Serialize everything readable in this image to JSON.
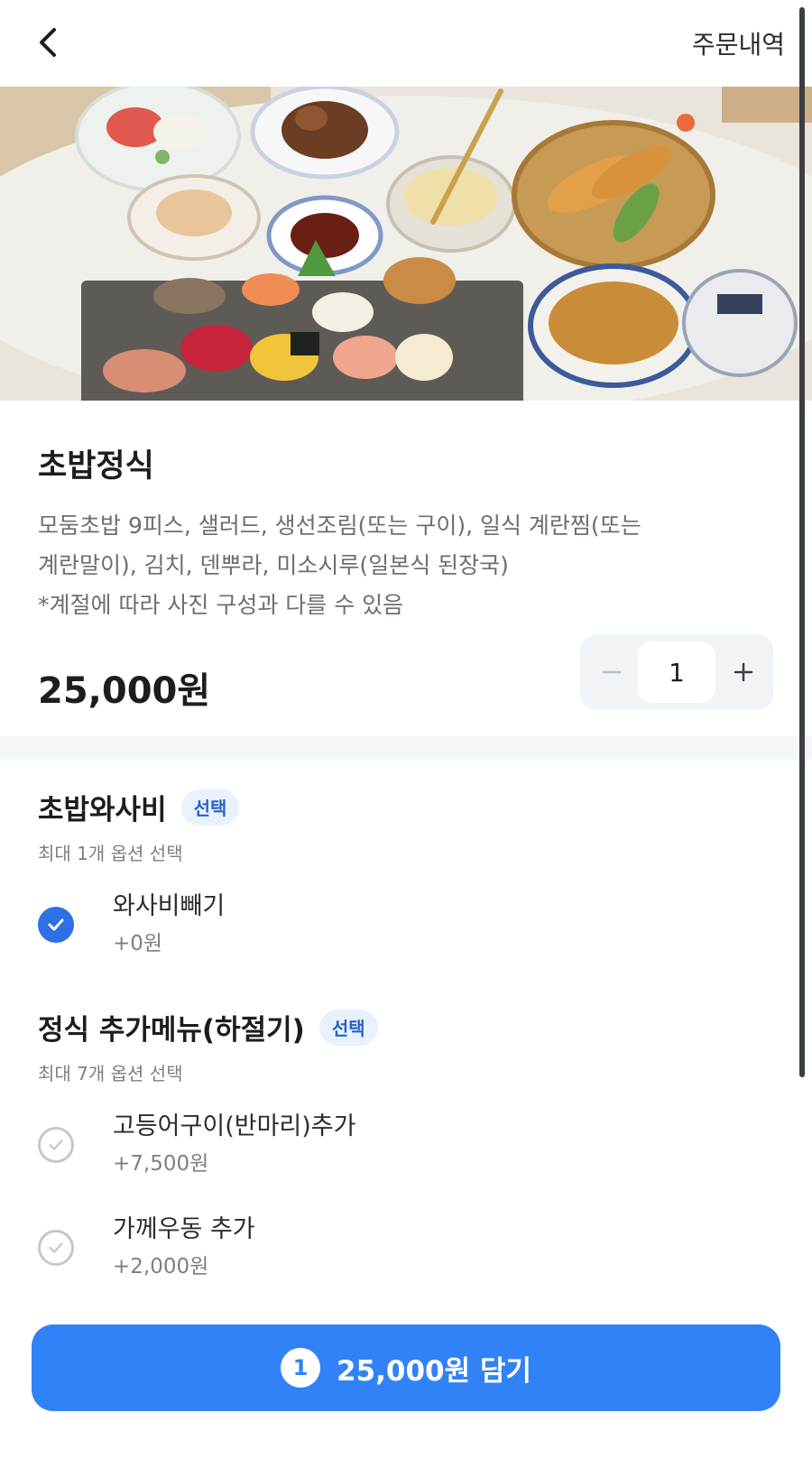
{
  "header": {
    "back_icon": "chevron-left-icon",
    "order_history_label": "주문내역"
  },
  "item": {
    "title": "초밥정식",
    "description_lines": [
      "모둠초밥 9피스, 샐러드, 생선조림(또는 구이), 일식 계란찜(또는",
      "계란말이), 김치, 덴뿌라, 미소시루(일본식 된장국)",
      "*계절에 따라 사진 구성과 다를 수 있음"
    ],
    "price": "25,000원",
    "quantity": "1",
    "minus_icon": "minus-icon",
    "plus_icon": "plus-icon"
  },
  "option_groups": [
    {
      "title": "초밥와사비",
      "badge": "선택",
      "subtitle": "최대 1개 옵션 선택",
      "options": [
        {
          "name": "와사비빼기",
          "price": "+0원",
          "checked": true
        }
      ]
    },
    {
      "title": "정식 추가메뉴(하절기)",
      "badge": "선택",
      "subtitle": "최대 7개 옵션 선택",
      "options": [
        {
          "name": "고등어구이(반마리)추가",
          "price": "+7,500원",
          "checked": false
        },
        {
          "name": "가께우동 추가",
          "price": "+2,000원",
          "checked": false
        }
      ]
    }
  ],
  "cta": {
    "count": "1",
    "label": "25,000원 담기"
  },
  "colors": {
    "accent": "#3182f6",
    "check_on": "#2f6fe4",
    "badge_bg": "#e9f1fd",
    "badge_text": "#2265c9"
  }
}
